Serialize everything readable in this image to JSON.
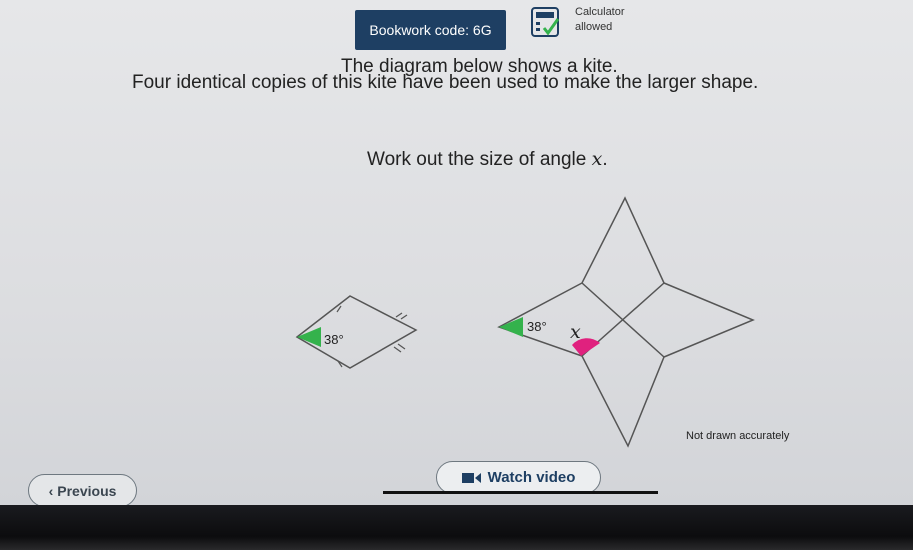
{
  "header": {
    "bookwork_code": "Bookwork code: 6G",
    "calculator_label": "Calculator",
    "calculator_status": "allowed"
  },
  "question": {
    "line1": "The diagram below shows a kite.",
    "line2": "Four identical copies of this kite have been used to make the larger shape.",
    "line3_prefix": "Work out the size of angle ",
    "line3_variable": "x",
    "line3_suffix": "."
  },
  "diagram": {
    "kite_angle": "38°",
    "shape_angle": "38°",
    "unknown_angle": "x",
    "note": "Not drawn accurately",
    "colors": {
      "angle_fill": "#34b24c",
      "unknown_fill": "#e0217e",
      "line": "#555555"
    }
  },
  "footer": {
    "previous_label": "Previous",
    "watch_video_label": "Watch video"
  }
}
